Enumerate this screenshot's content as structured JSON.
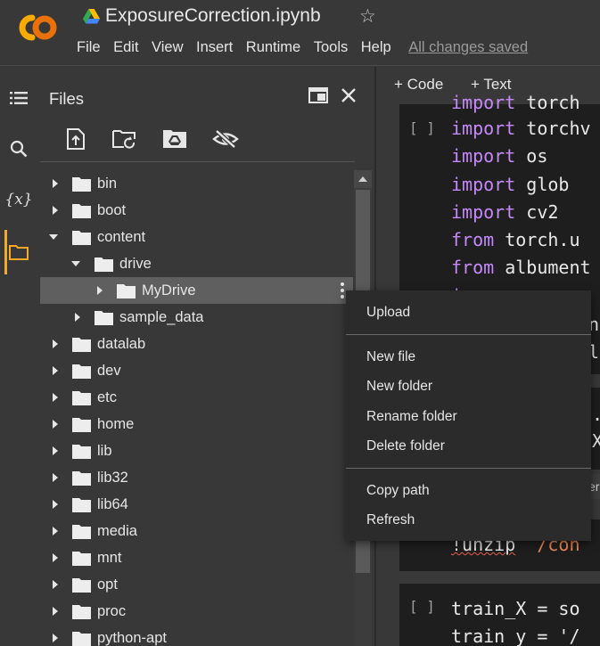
{
  "header": {
    "notebook_title": "ExposureCorrection.ipynb",
    "star_glyph": "☆",
    "logo_text": "CO",
    "menu": [
      "File",
      "Edit",
      "View",
      "Insert",
      "Runtime",
      "Tools",
      "Help"
    ],
    "save_status": "All changes saved"
  },
  "rail": {
    "icons": [
      "table-of-contents-icon",
      "search-icon",
      "variables-icon",
      "folder-icon"
    ],
    "variables_glyph": "{x}"
  },
  "files_panel": {
    "title": "Files",
    "toolbar_icons": [
      "upload-file-icon",
      "refresh-folder-icon",
      "mount-drive-icon",
      "hide-files-icon"
    ],
    "tree": [
      {
        "label": "bin",
        "expanded": false
      },
      {
        "label": "boot",
        "expanded": false
      },
      {
        "label": "content",
        "expanded": true
      },
      {
        "label": "drive",
        "expanded": true
      },
      {
        "label": "MyDrive",
        "expanded": false,
        "selected": true
      },
      {
        "label": "sample_data",
        "expanded": false
      },
      {
        "label": "datalab",
        "expanded": false
      },
      {
        "label": "dev",
        "expanded": false
      },
      {
        "label": "etc",
        "expanded": false
      },
      {
        "label": "home",
        "expanded": false
      },
      {
        "label": "lib",
        "expanded": false
      },
      {
        "label": "lib32",
        "expanded": false
      },
      {
        "label": "lib64",
        "expanded": false
      },
      {
        "label": "media",
        "expanded": false
      },
      {
        "label": "mnt",
        "expanded": false
      },
      {
        "label": "opt",
        "expanded": false
      },
      {
        "label": "proc",
        "expanded": false
      },
      {
        "label": "python-apt",
        "expanded": false
      }
    ]
  },
  "code_toolbar": {
    "add_code": "+ Code",
    "add_text": "+ Text"
  },
  "code_cells": {
    "run_marker": "[ ]",
    "cell1_lines": [
      {
        "kw": "import",
        "rest": " torch"
      },
      {
        "kw": "import",
        "rest": " torchv"
      },
      {
        "kw": "import",
        "rest": " os"
      },
      {
        "kw": "import",
        "rest": " glob"
      },
      {
        "kw": "import",
        "rest": " cv2"
      },
      {
        "kw": "from",
        "rest": " torch.u"
      },
      {
        "kw": "from",
        "rest": " albument"
      },
      {
        "kw": "i",
        "rest": ""
      },
      {
        "kw": "",
        "rest": "n"
      },
      {
        "kw": "",
        "rest": "le"
      }
    ],
    "cell2_fragments": [
      ".c",
      "X",
      "er"
    ],
    "cell3_cmd": "!unzip",
    "cell3_arg": "/con",
    "cell4_lines": [
      "train_X = so",
      "train_y = '/"
    ]
  },
  "context_menu": {
    "items": [
      "Upload",
      "New file",
      "New folder",
      "Rename folder",
      "Delete folder",
      "Copy path",
      "Refresh"
    ]
  },
  "colors": {
    "background": "#383838",
    "cell_background": "#1e1e1e",
    "keyword": "#c58af9",
    "string": "#f28b54",
    "accent": "#f9a825",
    "menu_background": "#2b2b2b"
  }
}
